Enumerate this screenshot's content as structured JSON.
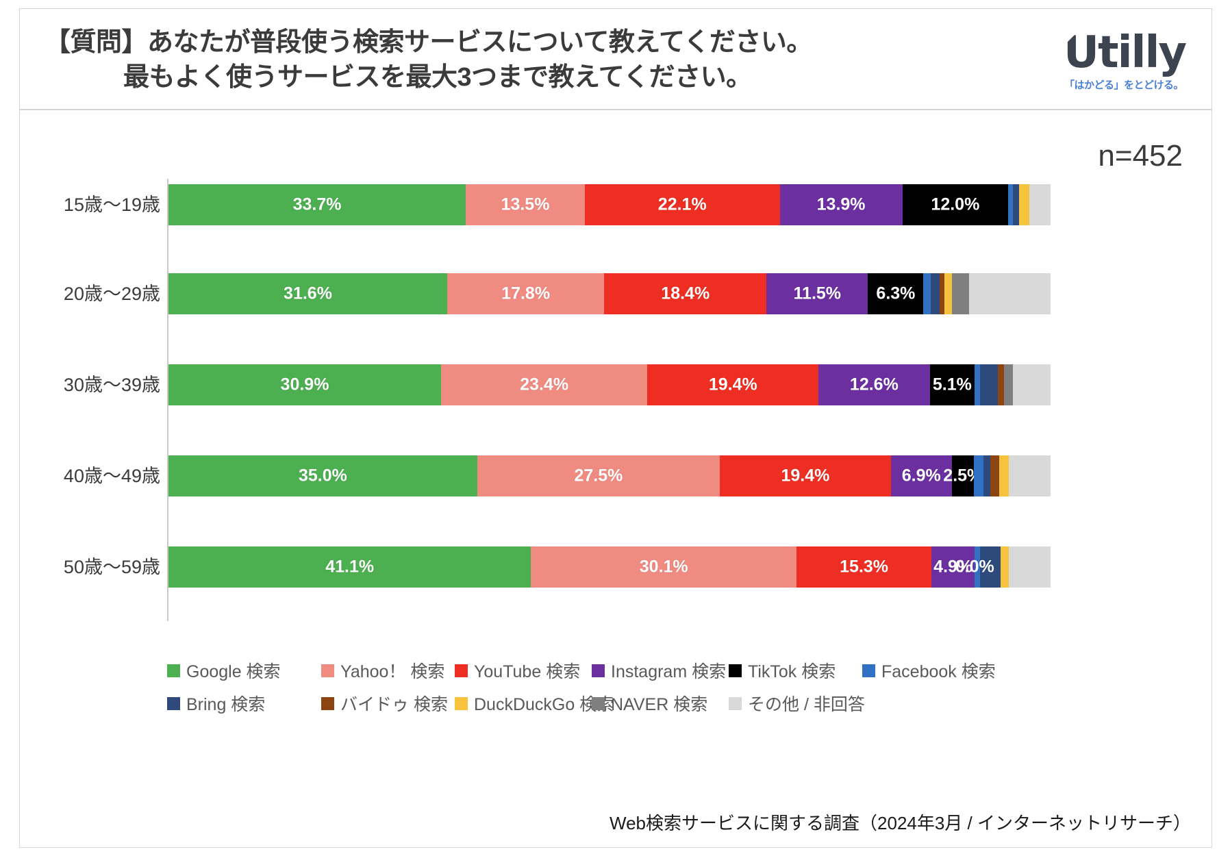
{
  "header": {
    "title_line1": "【質問】あなたが普段使う検索サービスについて教えてください。",
    "title_line2": "最もよく使うサービスを最大3つまで教えてください。",
    "logo_word": "Utilly",
    "logo_tagline": "「はかどる」をとどける。",
    "logo_color": "#3c4450",
    "logo_tagline_color": "#4a7fd4"
  },
  "sample_size_label": "n=452",
  "footer_note": "Web検索サービスに関する調査（2024年3月 / インターネットリサーチ）",
  "legend": {
    "rows": [
      [
        {
          "label": "Google 検索",
          "color": "#4CAF50"
        },
        {
          "label": "Yahoo！ 検索",
          "color": "#F08B82"
        },
        {
          "label": "YouTube 検索",
          "color": "#EE2E22"
        },
        {
          "label": "Instagram 検索",
          "color": "#6B2FA0"
        },
        {
          "label": "TikTok 検索",
          "color": "#000000"
        },
        {
          "label": "Facebook 検索",
          "color": "#3071C4"
        }
      ],
      [
        {
          "label": "Bring 検索",
          "color": "#2E4A7D"
        },
        {
          "label": "バイドゥ 検索",
          "color": "#8C4413"
        },
        {
          "label": "DuckDuckGo 検索",
          "color": "#F7C33C"
        },
        {
          "label": "NAVER 検索",
          "color": "#7F7F7F"
        },
        {
          "label": "その他 / 非回答",
          "color": "#D9D9D9"
        }
      ]
    ]
  },
  "chart_data": {
    "type": "bar",
    "subtype": "stacked-horizontal-100",
    "title": "【質問】あなたが普段使う検索サービスについて教えてください。最もよく使うサービスを最大3つまで教えてください。",
    "xlabel": "",
    "ylabel": "",
    "xlim": [
      0,
      100
    ],
    "grid": false,
    "legend_position": "bottom",
    "value_suffix": "%",
    "sample_size": 452,
    "categories": [
      "15歳～19歳",
      "20歳～29歳",
      "30歳～39歳",
      "40歳～49歳",
      "50歳～59歳"
    ],
    "series": [
      {
        "name": "Google 検索",
        "color": "#4CAF50",
        "values": [
          33.7,
          31.6,
          30.9,
          35.0,
          41.1
        ],
        "labels": [
          "33.7%",
          "31.6%",
          "30.9%",
          "35.0%",
          "41.1%"
        ]
      },
      {
        "name": "Yahoo！ 検索",
        "color": "#F08B82",
        "values": [
          13.5,
          17.8,
          23.4,
          27.5,
          30.1
        ],
        "labels": [
          "13.5%",
          "17.8%",
          "23.4%",
          "27.5%",
          "30.1%"
        ]
      },
      {
        "name": "YouTube 検索",
        "color": "#EE2E22",
        "values": [
          22.1,
          18.4,
          19.4,
          19.4,
          15.3
        ],
        "labels": [
          "22.1%",
          "18.4%",
          "19.4%",
          "19.4%",
          "15.3%"
        ]
      },
      {
        "name": "Instagram 検索",
        "color": "#6B2FA0",
        "values": [
          13.9,
          11.5,
          12.6,
          6.9,
          4.9
        ],
        "labels": [
          "13.9%",
          "11.5%",
          "12.6%",
          "6.9%",
          "4.9%"
        ]
      },
      {
        "name": "TikTok 検索",
        "color": "#000000",
        "values": [
          12.0,
          6.3,
          5.1,
          2.5,
          0.0
        ],
        "labels": [
          "12.0%",
          "6.3%",
          "5.1%",
          "2.5%",
          "0.0%"
        ]
      },
      {
        "name": "Facebook 検索",
        "color": "#3071C4",
        "values": [
          0.5,
          0.8,
          0.6,
          1.1,
          0.6
        ],
        "labels": [
          "",
          "",
          "",
          "",
          ""
        ]
      },
      {
        "name": "Bring 検索",
        "color": "#2E4A7D",
        "values": [
          0.7,
          1.0,
          2.0,
          0.8,
          2.3
        ],
        "labels": [
          "",
          "",
          "",
          "",
          ""
        ]
      },
      {
        "name": "バイドゥ 検索",
        "color": "#8C4413",
        "values": [
          0.0,
          0.6,
          0.7,
          1.0,
          0.0
        ],
        "labels": [
          "",
          "",
          "",
          "",
          ""
        ]
      },
      {
        "name": "DuckDuckGo 検索",
        "color": "#F7C33C",
        "values": [
          1.2,
          0.8,
          0.0,
          1.1,
          1.0
        ],
        "labels": [
          "",
          "",
          "",
          "",
          ""
        ]
      },
      {
        "name": "NAVER 検索",
        "color": "#7F7F7F",
        "values": [
          0.0,
          2.0,
          1.0,
          0.0,
          0.0
        ],
        "labels": [
          "",
          "",
          "",
          "",
          ""
        ]
      },
      {
        "name": "その他 / 非回答",
        "color": "#D9D9D9",
        "values": [
          2.4,
          9.2,
          4.3,
          4.7,
          4.7
        ],
        "labels": [
          "",
          "",
          "",
          "",
          ""
        ]
      }
    ]
  }
}
